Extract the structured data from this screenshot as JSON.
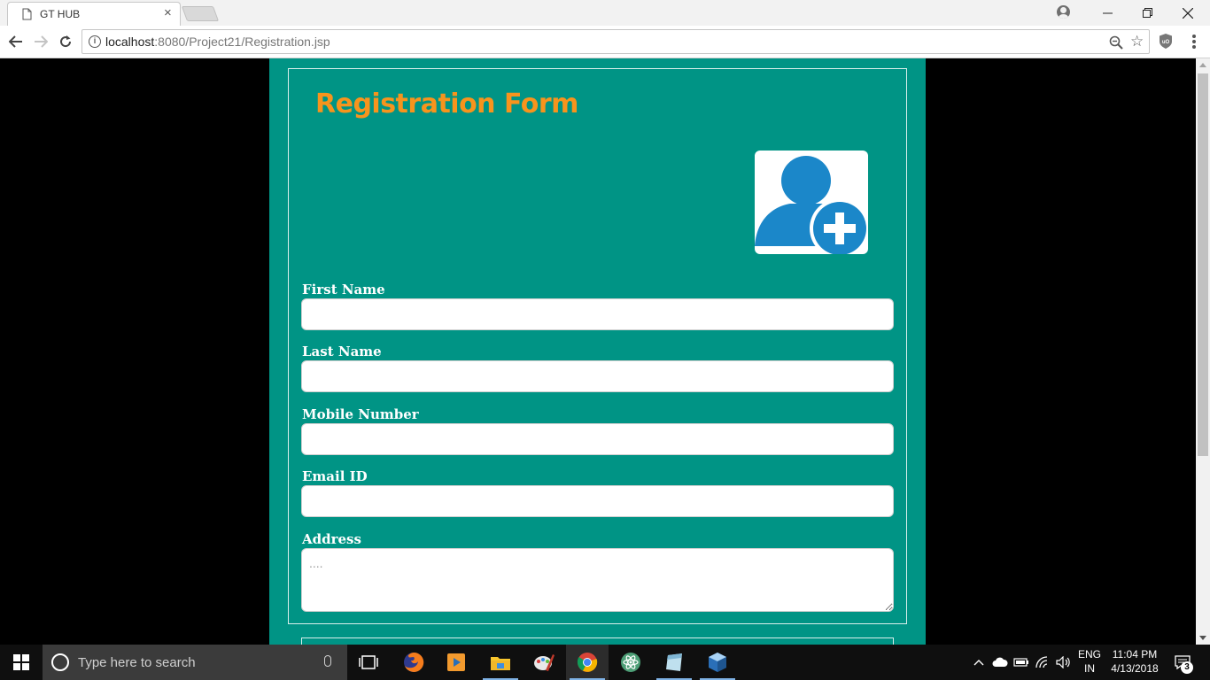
{
  "browser": {
    "tab_title": "GT HUB",
    "tab_close": "×",
    "url_host": "localhost",
    "url_rest": ":8080/Project21/Registration.jsp"
  },
  "form": {
    "title": "Registration Form",
    "avatar_icon": "add-user-icon",
    "fields": [
      {
        "label": "First Name",
        "value": "",
        "placeholder": ""
      },
      {
        "label": "Last Name",
        "value": "",
        "placeholder": ""
      },
      {
        "label": "Mobile Number",
        "value": "",
        "placeholder": ""
      },
      {
        "label": "Email ID",
        "value": "",
        "placeholder": ""
      },
      {
        "label": "Address",
        "value": "",
        "placeholder": "...."
      }
    ]
  },
  "taskbar": {
    "search_placeholder": "Type here to search",
    "language": "ENG",
    "region": "IN",
    "time": "11:04 PM",
    "date": "4/13/2018",
    "notification_count": "3"
  },
  "colors": {
    "page_background": "#009485",
    "title": "#f7941d",
    "avatar_blue": "#1b87c9"
  }
}
